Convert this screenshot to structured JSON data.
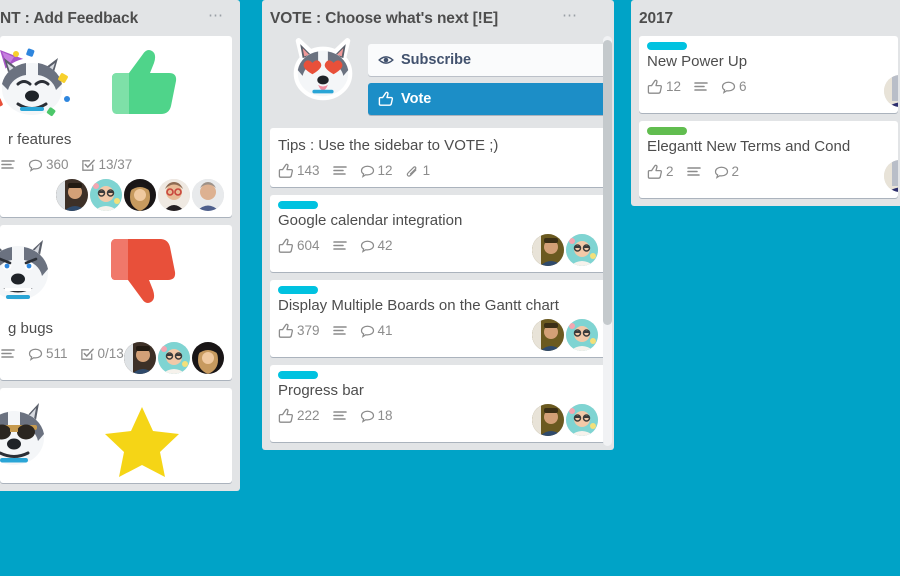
{
  "board": {
    "background_color": "#00a3c7",
    "list_background": "#e2e4e6"
  },
  "colors": {
    "label_cyan": "#00c2e0",
    "label_green": "#61bd4f",
    "vote_button": "#1c8ec7",
    "badge_text": "#8c8c8c",
    "card_title": "#4d4d4d"
  },
  "lists": [
    {
      "title": "NT : Add Feedback",
      "menu_label": "⋯",
      "cards": [
        {
          "title": "r features",
          "stickers": [
            "husky-party-sticker",
            "thumbs-up-green-sticker"
          ],
          "badges": {
            "description": true,
            "comments": "360",
            "checklist": "13/37"
          },
          "members": 5
        },
        {
          "title": "g bugs",
          "stickers": [
            "husky-angry-sticker",
            "thumbs-down-red-sticker"
          ],
          "badges": {
            "description": true,
            "comments": "511",
            "checklist": "0/13"
          },
          "members": 3
        },
        {
          "title": "",
          "stickers": [
            "husky-sunglasses-sticker",
            "star-yellow-sticker"
          ],
          "badges": {},
          "members": 0
        }
      ]
    },
    {
      "title": "VOTE : Choose what's next [!E]",
      "menu_label": "⋯",
      "actions": {
        "subscribe_label": "Subscribe",
        "subscribe_icon": "eye-icon",
        "vote_label": "Vote",
        "vote_icon": "thumbs-up-icon",
        "sticker": "husky-heart-eyes-sticker"
      },
      "cards": [
        {
          "title": "Tips : Use the sidebar to VOTE ;)",
          "labels": [],
          "badges": {
            "votes": "143",
            "description": true,
            "comments": "12",
            "attachments": "1"
          },
          "members": 0
        },
        {
          "title": "Google calendar integration",
          "labels": [
            "#00c2e0"
          ],
          "badges": {
            "votes": "604",
            "description": true,
            "comments": "42"
          },
          "members": 2
        },
        {
          "title": "Display Multiple Boards on the Gantt chart",
          "labels": [
            "#00c2e0"
          ],
          "badges": {
            "votes": "379",
            "description": true,
            "comments": "41"
          },
          "members": 2
        },
        {
          "title": "Progress bar",
          "labels": [
            "#00c2e0"
          ],
          "badges": {
            "votes": "222",
            "description": true,
            "comments": "18"
          },
          "members": 2
        }
      ],
      "scrollbar": {
        "visible": true
      }
    },
    {
      "title": "2017",
      "menu_label": "",
      "cards": [
        {
          "title": "New Power Up",
          "labels": [
            "#00c2e0"
          ],
          "badges": {
            "votes": "12",
            "description": true,
            "comments": "6"
          },
          "members": 1
        },
        {
          "title": "Elegantt New Terms and Cond",
          "labels": [
            "#61bd4f"
          ],
          "badges": {
            "votes": "2",
            "description": true,
            "comments": "2"
          },
          "members": 1
        }
      ]
    }
  ]
}
